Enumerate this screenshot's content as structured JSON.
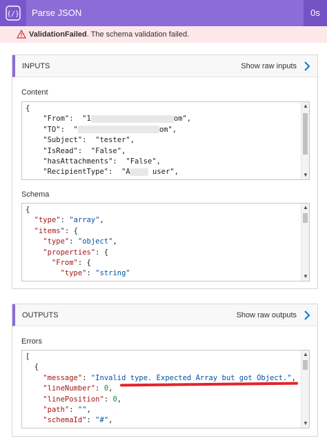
{
  "header": {
    "title": "Parse JSON",
    "duration": "0s"
  },
  "error": {
    "code": "ValidationFailed",
    "message": ". The schema validation failed."
  },
  "inputs": {
    "title": "INPUTS",
    "raw_link": "Show raw inputs",
    "content_label": "Content",
    "schema_label": "Schema"
  },
  "outputs": {
    "title": "OUTPUTS",
    "raw_link": "Show raw outputs",
    "errors_label": "Errors"
  }
}
